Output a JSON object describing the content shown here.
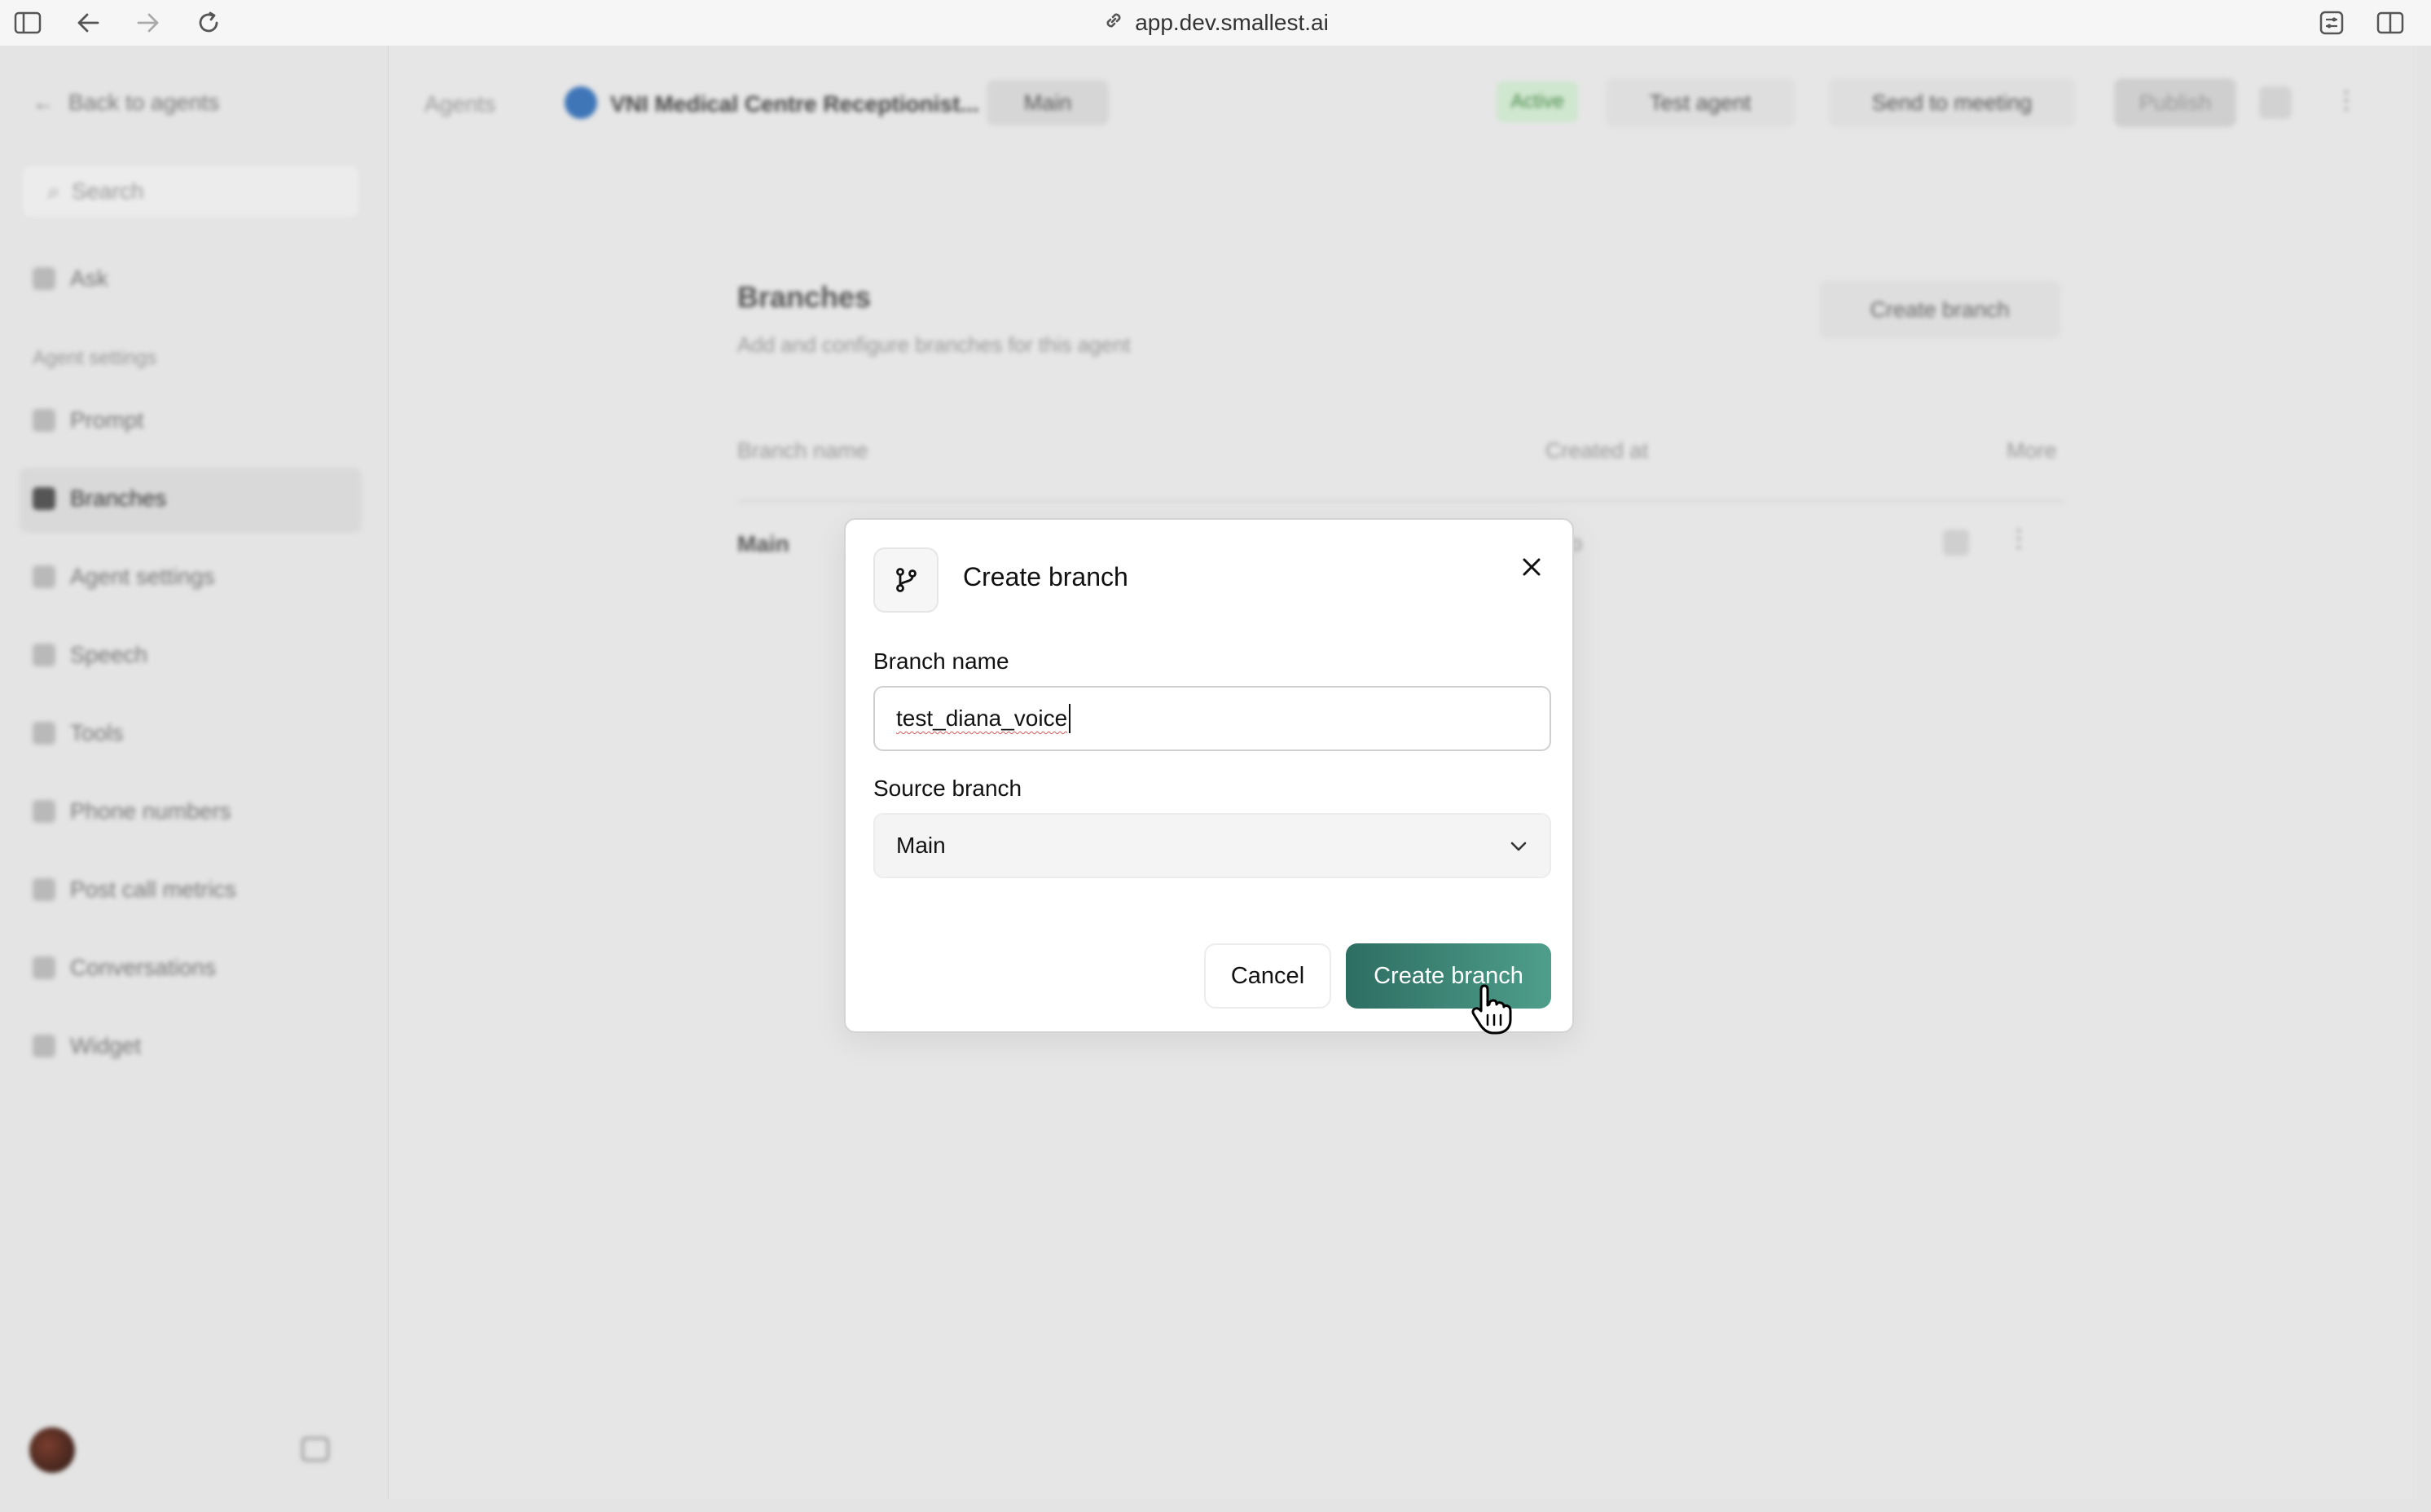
{
  "browser": {
    "url": "app.dev.smallest.ai"
  },
  "sidebar": {
    "back_label": "Back to agents",
    "search_placeholder": "Search",
    "items": [
      "Ask",
      "Prompt",
      "Branches",
      "Agent settings",
      "Speech",
      "Tools",
      "Phone numbers",
      "Post call metrics",
      "Conversations",
      "Widget"
    ],
    "section_label": "Agent settings"
  },
  "header": {
    "breadcrumb_root": "Agents",
    "agent_name": "VNI Medical Centre Receptionist...",
    "branch_selector": "Main",
    "status_badge": "Active",
    "test_agent_label": "Test agent",
    "send_meeting_label": "Send to meeting",
    "publish_label": "Publish"
  },
  "page": {
    "title": "Branches",
    "subtitle": "Add and configure branches for this agent",
    "create_button": "Create branch",
    "columns": [
      "Branch name",
      "Created at",
      "More"
    ],
    "rows": [
      {
        "name": "Main",
        "created": "ago"
      }
    ]
  },
  "modal": {
    "title": "Create branch",
    "branch_name_label": "Branch name",
    "branch_name_value": "test_diana_voice",
    "source_branch_label": "Source branch",
    "source_branch_value": "Main",
    "cancel_label": "Cancel",
    "submit_label": "Create branch"
  },
  "colors": {
    "primary_start": "#2d6e62",
    "primary_end": "#4f9e8b"
  }
}
